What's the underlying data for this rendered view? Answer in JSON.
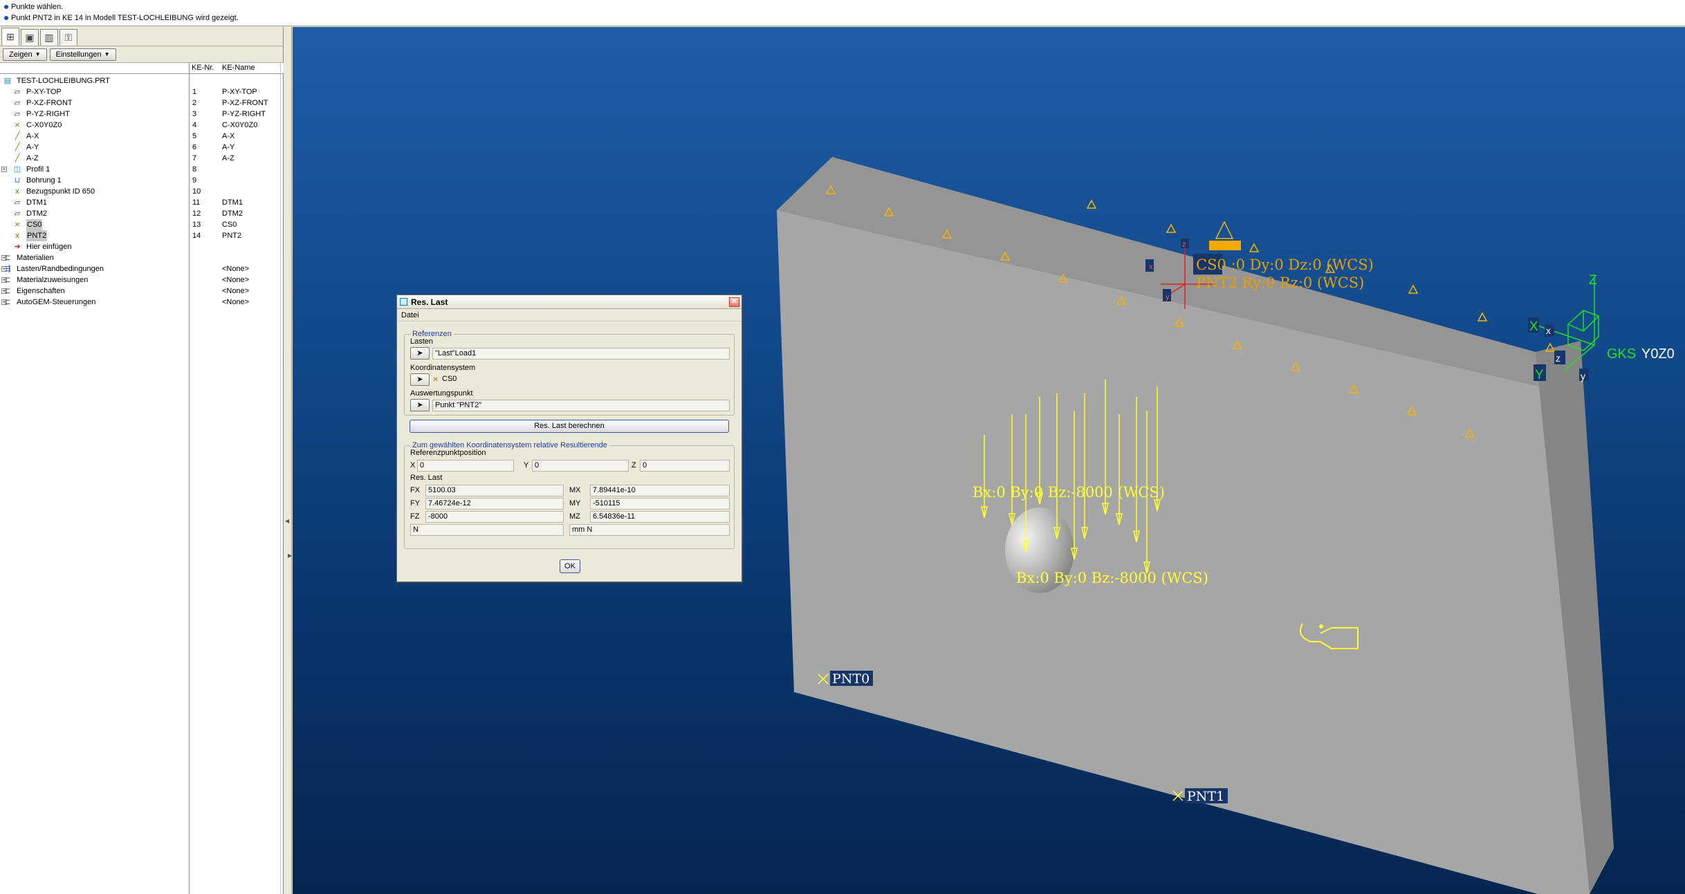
{
  "messages": [
    "Punkte wählen.",
    "Punkt PNT2 in KE 14 in Modell TEST-LOCHLEIBUNG wird gezeigt."
  ],
  "toolbar": {
    "show_label": "Zeigen",
    "settings_label": "Einstellungen"
  },
  "tree_columns": {
    "nr": "KE-Nr.",
    "name": "KE-Name"
  },
  "tree": [
    {
      "label": "TEST-LOCHLEIBUNG.PRT",
      "nr": "",
      "name": "",
      "icon": "part-icon",
      "glyph": "▤",
      "color": "#1a8aa8",
      "indent": 0,
      "expand": ""
    },
    {
      "label": "P-XY-TOP",
      "nr": "1",
      "name": "P-XY-TOP",
      "icon": "datum-plane-icon",
      "glyph": "⏥",
      "color": "#333",
      "indent": 1,
      "expand": ""
    },
    {
      "label": "P-XZ-FRONT",
      "nr": "2",
      "name": "P-XZ-FRONT",
      "icon": "datum-plane-icon",
      "glyph": "⏥",
      "color": "#333",
      "indent": 1,
      "expand": ""
    },
    {
      "label": "P-YZ-RIGHT",
      "nr": "3",
      "name": "P-YZ-RIGHT",
      "icon": "datum-plane-icon",
      "glyph": "⏥",
      "color": "#333",
      "indent": 1,
      "expand": ""
    },
    {
      "label": "C-X0Y0Z0",
      "nr": "4",
      "name": "C-X0Y0Z0",
      "icon": "coordinate-system-icon",
      "glyph": "⨯",
      "color": "#b36b00",
      "indent": 1,
      "expand": ""
    },
    {
      "label": "A-X",
      "nr": "5",
      "name": "A-X",
      "icon": "datum-axis-icon",
      "glyph": "╱",
      "color": "#b36b00",
      "indent": 1,
      "expand": ""
    },
    {
      "label": "A-Y",
      "nr": "6",
      "name": "A-Y",
      "icon": "datum-axis-icon",
      "glyph": "╱",
      "color": "#b36b00",
      "indent": 1,
      "expand": ""
    },
    {
      "label": "A-Z",
      "nr": "7",
      "name": "A-Z",
      "icon": "datum-axis-icon",
      "glyph": "╱",
      "color": "#b36b00",
      "indent": 1,
      "expand": ""
    },
    {
      "label": "Profil 1",
      "nr": "8",
      "name": "",
      "icon": "extrude-icon",
      "glyph": "◫",
      "color": "#1a8aa8",
      "indent": 1,
      "expand": "+"
    },
    {
      "label": "Bohrung 1",
      "nr": "9",
      "name": "",
      "icon": "hole-icon",
      "glyph": "⊔",
      "color": "#1a8aa8",
      "indent": 1,
      "expand": ""
    },
    {
      "label": "Bezugspunkt ID 650",
      "nr": "10",
      "name": "",
      "icon": "datum-point-icon",
      "glyph": "ⅹ",
      "color": "#b36b00",
      "indent": 1,
      "expand": ""
    },
    {
      "label": "DTM1",
      "nr": "11",
      "name": "DTM1",
      "icon": "datum-plane-icon",
      "glyph": "⏥",
      "color": "#333",
      "indent": 1,
      "expand": ""
    },
    {
      "label": "DTM2",
      "nr": "12",
      "name": "DTM2",
      "icon": "datum-plane-icon",
      "glyph": "⏥",
      "color": "#333",
      "indent": 1,
      "expand": ""
    },
    {
      "label": "CS0",
      "nr": "13",
      "name": "CS0",
      "icon": "coordinate-system-icon",
      "glyph": "⨯",
      "color": "#b36b00",
      "indent": 1,
      "expand": "",
      "selected": true
    },
    {
      "label": "PNT2",
      "nr": "14",
      "name": "PNT2",
      "icon": "datum-point-icon",
      "glyph": "ⅹ",
      "color": "#b36b00",
      "indent": 1,
      "expand": "",
      "selected": true
    },
    {
      "label": "Hier einfügen",
      "nr": "",
      "name": "",
      "icon": "insert-here-icon",
      "glyph": "➔",
      "color": "#c81e1e",
      "indent": 1,
      "expand": ""
    },
    {
      "label": "Materialien",
      "nr": "",
      "name": "",
      "icon": "folder-icon",
      "glyph": "⊏",
      "color": "#555",
      "indent": 0,
      "expand": "+"
    },
    {
      "label": "Lasten/Randbedingungen",
      "nr": "",
      "name": "<None>",
      "icon": "loads-icon",
      "glyph": "⇶",
      "color": "#1a4fb0",
      "indent": 0,
      "expand": "+"
    },
    {
      "label": "Materialzuweisungen",
      "nr": "",
      "name": "<None>",
      "icon": "material-assign-icon",
      "glyph": "⊏",
      "color": "#555",
      "indent": 0,
      "expand": "+"
    },
    {
      "label": "Eigenschaften",
      "nr": "",
      "name": "<None>",
      "icon": "properties-icon",
      "glyph": "⊏",
      "color": "#555",
      "indent": 0,
      "expand": "+"
    },
    {
      "label": "AutoGEM-Steuerungen",
      "nr": "",
      "name": "<None>",
      "icon": "autogem-icon",
      "glyph": "⊏",
      "color": "#555",
      "indent": 0,
      "expand": "+"
    }
  ],
  "dialog": {
    "title": "Res. Last",
    "menu": "Datei",
    "group1_title": "Referenzen",
    "loads_label": "Lasten",
    "loads_value": "\"Last\"Load1",
    "cs_label": "Koordinatensystem",
    "cs_value": "CS0",
    "eval_label": "Auswertungspunkt",
    "eval_value": "Punkt \"PNT2\"",
    "compute_button": "Res. Last berechnen",
    "group2_title": "Zum gewählten Koordinatensystem relative Resultierende",
    "refpos_label": "Referenzpunktposition",
    "x_label": "X",
    "x_value": "0",
    "y_label": "Y",
    "y_value": "0",
    "z_label": "Z",
    "z_value": "0",
    "reslast_label": "Res. Last",
    "fx_label": "FX",
    "fx_value": "5100.03",
    "fy_label": "FY",
    "fy_value": "7.46724e-12",
    "fz_label": "FZ",
    "fz_value": "-8000",
    "mx_label": "MX",
    "mx_value": "7.89441e-10",
    "my_label": "MY",
    "my_value": "-510115",
    "mz_label": "MZ",
    "mz_value": "6.54836e-11",
    "force_unit": "N",
    "moment_unit": "mm N",
    "ok_button": "OK"
  },
  "viewport": {
    "label_cs_top": "CS0 :0 Dy:0 Dz:0 (WCS)",
    "label_cs_bottom": "PNT2  Ry:0 Rz:0 (WCS)",
    "label_load_1": "Bx:0 By:0 Bz:-8000 (WCS)",
    "label_load_2": "Bx:0 By:0 Bz:-8000 (WCS)",
    "gks_label": "GKS",
    "y0z0_label": "Y0Z0",
    "pnt0": "PNT0",
    "pnt1": "PNT1",
    "axis_x": "X",
    "axis_y": "Y",
    "axis_z": "Z",
    "small_x": "x",
    "small_y": "y",
    "small_z": "z",
    "cs_x": "x",
    "cs_y": "y",
    "cs_z": "z",
    "colors": {
      "load": "#ffff30",
      "label_orange": "#e8a000",
      "constraint": "#f5b400",
      "axis_green": "#20e020",
      "plate": "#a6a6a6",
      "plate_top": "#959595",
      "plate_side": "#858585"
    }
  }
}
